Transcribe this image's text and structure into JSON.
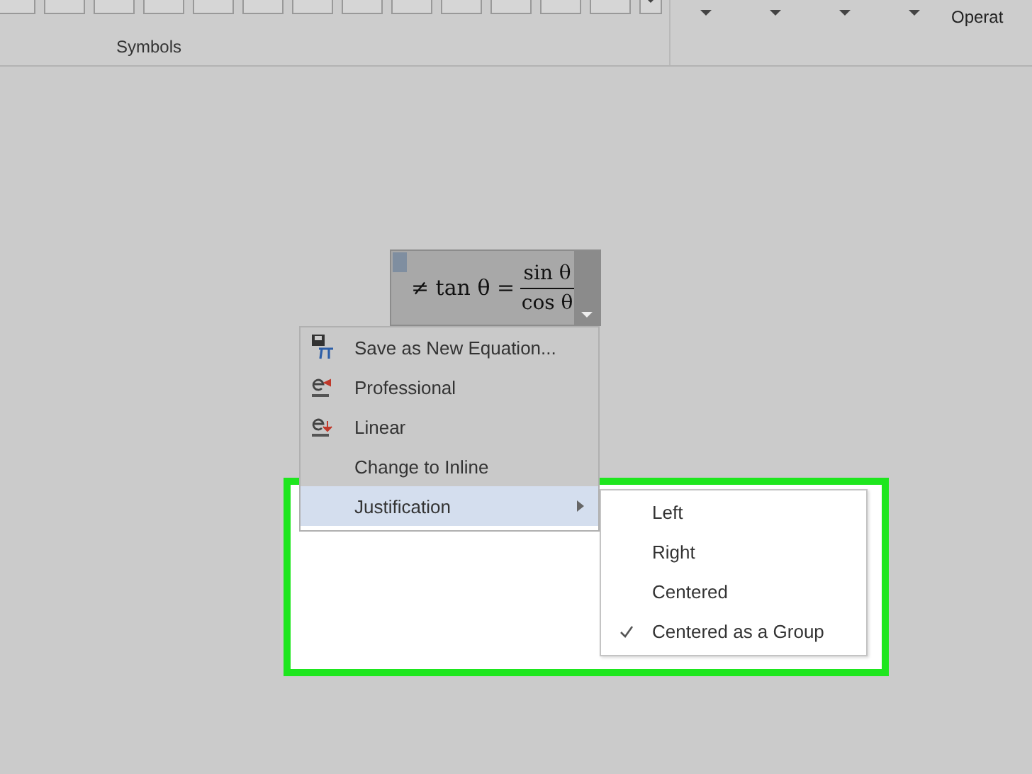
{
  "ribbon": {
    "group_label": "Symbols",
    "cut_label": "Operat"
  },
  "equation": {
    "lead": "≠ tan θ =",
    "numerator": "sin θ",
    "denominator": "cos θ"
  },
  "context_menu": {
    "items": [
      {
        "label": "Save as New Equation...",
        "kind": "command",
        "selected": false
      },
      {
        "label": "Professional",
        "kind": "command",
        "selected": false
      },
      {
        "label": "Linear",
        "kind": "command",
        "selected": false
      },
      {
        "label": "Change to Inline",
        "kind": "command",
        "selected": false
      },
      {
        "label": "Justification",
        "kind": "submenu",
        "selected": true
      }
    ]
  },
  "submenu": {
    "items": [
      {
        "label": "Left",
        "checked": false
      },
      {
        "label": "Right",
        "checked": false
      },
      {
        "label": "Centered",
        "checked": false
      },
      {
        "label": "Centered as a Group",
        "checked": true
      }
    ]
  }
}
